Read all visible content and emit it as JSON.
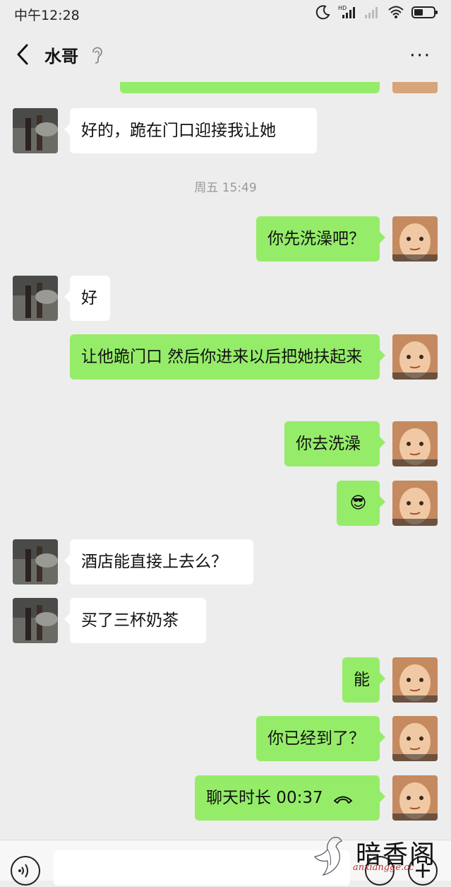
{
  "status_bar": {
    "time": "中午12:28",
    "icons": [
      "moon-icon",
      "hd-signal-icon",
      "signal-empty-icon",
      "wifi-icon",
      "battery-icon"
    ]
  },
  "header": {
    "title": "水哥",
    "back_icon": "chevron-left-icon",
    "ear_icon": "ear-icon",
    "more_icon": "more-icon",
    "more_label": "···"
  },
  "messages": [
    {
      "side": "in",
      "text": "好的，跪在门口迎接我让她"
    },
    {
      "type": "timestamp",
      "text": "周五 15:49"
    },
    {
      "side": "out",
      "text": "你先洗澡吧？"
    },
    {
      "side": "in",
      "text": "好"
    },
    {
      "side": "out",
      "text": "让他跪门口  然后你进来以后把她扶起来"
    },
    {
      "side": "out",
      "text": "你去洗澡"
    },
    {
      "side": "out",
      "text": "😎"
    },
    {
      "side": "in",
      "text": "酒店能直接上去么？"
    },
    {
      "side": "in",
      "text": "买了三杯奶茶"
    },
    {
      "side": "out",
      "text": "能"
    },
    {
      "side": "out",
      "text": "你已经到了？"
    },
    {
      "side": "out",
      "text": "聊天时长 00:37",
      "icon": "hangup-icon"
    }
  ],
  "input_bar": {
    "voice_icon": "voice-icon",
    "emoji_icon": "emoji-icon",
    "plus_icon": "plus-icon",
    "plus_label": "+"
  },
  "watermark": {
    "title": "暗香阁",
    "url": "anxiangge.cc"
  },
  "colors": {
    "background": "#ededed",
    "bubble_out": "#95ec69",
    "bubble_in": "#ffffff"
  }
}
